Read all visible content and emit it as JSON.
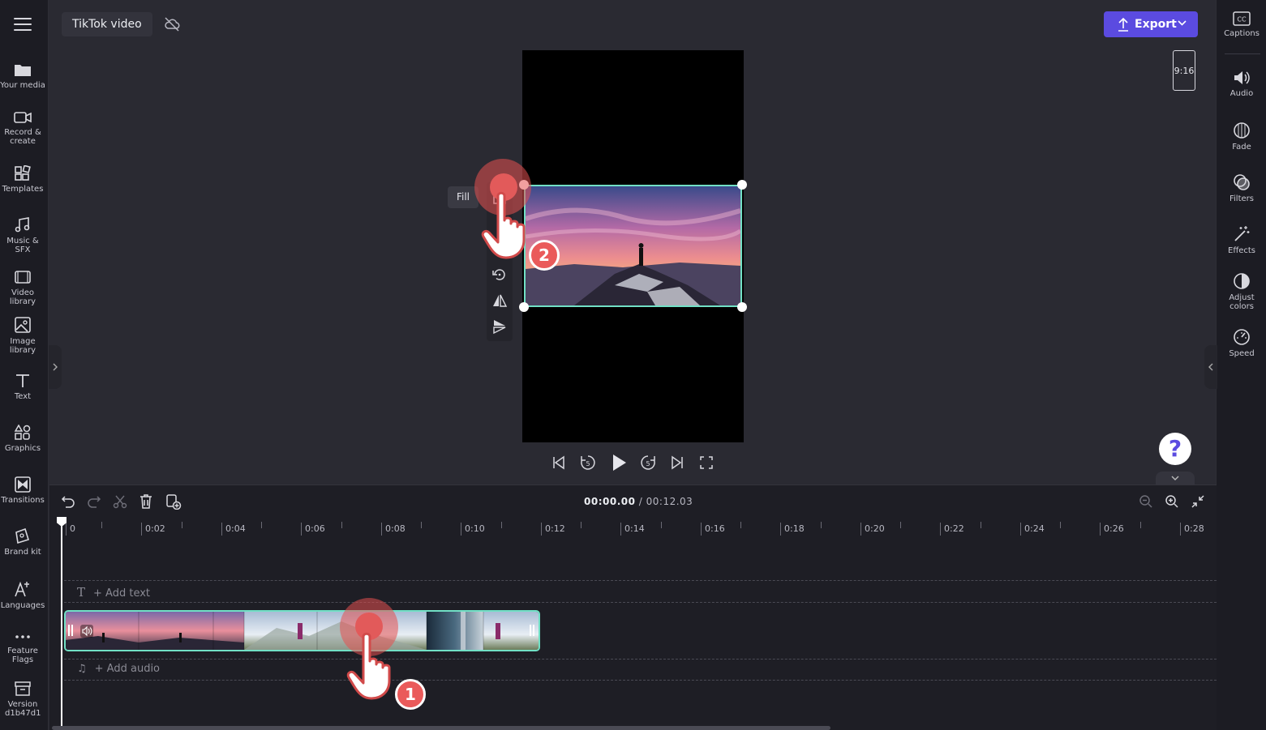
{
  "header": {
    "project_title": "TikTok video",
    "export_label": "Export",
    "aspect_ratio": "9:16"
  },
  "left_sidebar": [
    {
      "label": "Your media",
      "icon": "folder-icon"
    },
    {
      "label": "Record & create",
      "icon": "camera-icon"
    },
    {
      "label": "Templates",
      "icon": "templates-icon"
    },
    {
      "label": "Music & SFX",
      "icon": "music-icon"
    },
    {
      "label": "Video library",
      "icon": "film-icon"
    },
    {
      "label": "Image library",
      "icon": "image-icon"
    },
    {
      "label": "Text",
      "icon": "text-icon"
    },
    {
      "label": "Graphics",
      "icon": "shapes-icon"
    },
    {
      "label": "Transitions",
      "icon": "transition-icon"
    },
    {
      "label": "Brand kit",
      "icon": "brand-icon"
    },
    {
      "label": "Languages",
      "icon": "language-icon"
    },
    {
      "label": "Feature Flags",
      "icon": "more-icon"
    },
    {
      "label": "Version d1b47d1",
      "icon": "archive-icon"
    }
  ],
  "right_sidebar": [
    {
      "label": "Captions",
      "icon": "cc-icon"
    },
    {
      "label": "Audio",
      "icon": "speaker-icon"
    },
    {
      "label": "Fade",
      "icon": "fade-icon"
    },
    {
      "label": "Filters",
      "icon": "filters-icon"
    },
    {
      "label": "Effects",
      "icon": "wand-icon"
    },
    {
      "label": "Adjust colors",
      "icon": "contrast-icon"
    },
    {
      "label": "Speed",
      "icon": "speed-icon"
    }
  ],
  "preview": {
    "fill_tooltip": "Fill"
  },
  "overlays": {
    "step_1": "1",
    "step_2": "2"
  },
  "help": {
    "label": "?"
  },
  "timeline": {
    "current_time": "00:00.00",
    "separator": " / ",
    "total_time": "00:12.03",
    "ruler_labels": [
      "0",
      "0:02",
      "0:04",
      "0:06",
      "0:08",
      "0:10",
      "0:12",
      "0:14",
      "0:16",
      "0:18",
      "0:20",
      "0:22",
      "0:24",
      "0:26",
      "0:28"
    ],
    "add_text": "+ Add text",
    "add_audio": "+ Add audio"
  },
  "colors": {
    "accent": "#5b4be0",
    "selection": "#71e0c5",
    "tap": "#e25a5a"
  }
}
